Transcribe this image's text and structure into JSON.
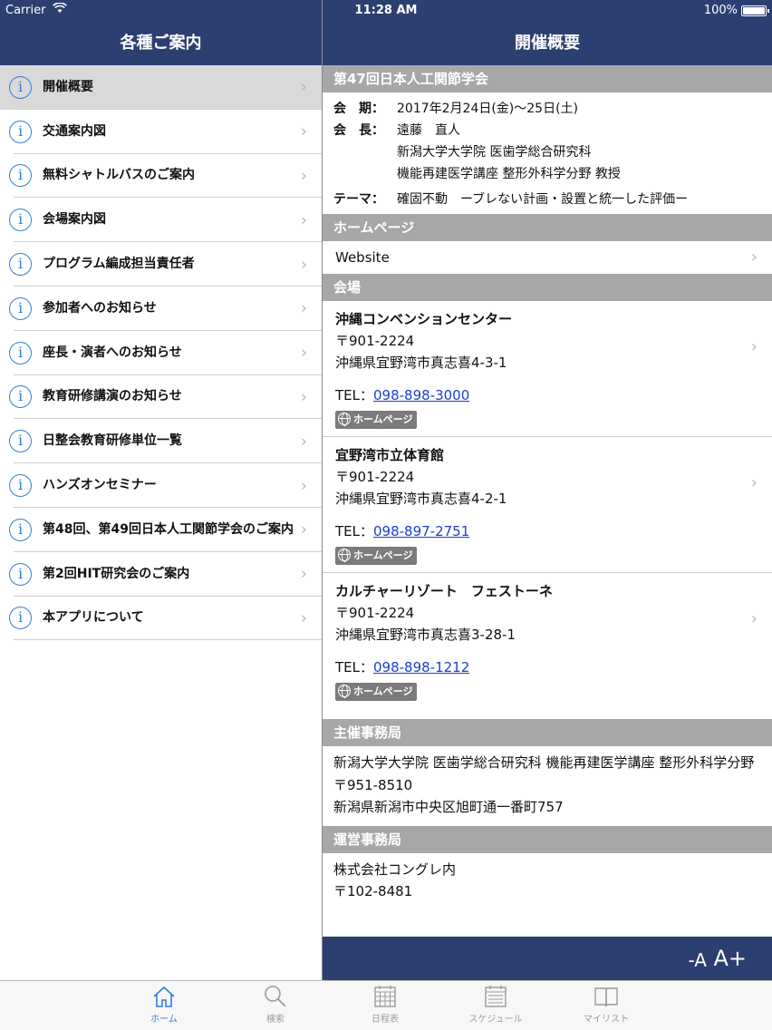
{
  "status": {
    "carrier": "Carrier",
    "time": "11:28 AM",
    "battery": "100%"
  },
  "left": {
    "title": "各種ご案内",
    "items": [
      {
        "label": "開催概要",
        "selected": true
      },
      {
        "label": "交通案内図"
      },
      {
        "label": "無料シャトルバスのご案内"
      },
      {
        "label": "会場案内図"
      },
      {
        "label": "プログラム編成担当責任者"
      },
      {
        "label": "参加者へのお知らせ"
      },
      {
        "label": "座長・演者へのお知らせ"
      },
      {
        "label": "教育研修講演のお知らせ"
      },
      {
        "label": "日整会教育研修単位一覧"
      },
      {
        "label": "ハンズオンセミナー"
      },
      {
        "label": "第48回、第49回日本人工関節学会のご案内"
      },
      {
        "label": "第2回HIT研究会のご案内"
      },
      {
        "label": "本アプリについて"
      }
    ]
  },
  "right": {
    "title": "開催概要",
    "conference_title": "第47回日本人工関節学会",
    "period_key": "会　期：",
    "period_value": "2017年2月24日(金)〜25日(土)",
    "chair_key": "会　長：",
    "chair_name": "遠藤　直人",
    "chair_affil1": "新潟大学大学院 医歯学総合研究科",
    "chair_affil2": "機能再建医学講座 整形外科学分野 教授",
    "theme_key": "テーマ：",
    "theme_value": "確固不動　ーブレない計画・設置と統一した評価ー",
    "homepage_header": "ホームページ",
    "website_label": "Website",
    "venue_header": "会場",
    "venues": [
      {
        "name": "沖縄コンベンションセンター",
        "zip": "〒901-2224",
        "address": "沖縄県宜野湾市真志喜4-3-1",
        "tel_label": "TEL：",
        "tel": "098-898-3000",
        "hp": "ホームページ"
      },
      {
        "name": "宜野湾市立体育館",
        "zip": "〒901-2224",
        "address": "沖縄県宜野湾市真志喜4-2-1",
        "tel_label": "TEL：",
        "tel": "098-897-2751",
        "hp": "ホームページ"
      },
      {
        "name": "カルチャーリゾート　フェストーネ",
        "zip": "〒901-2224",
        "address": "沖縄県宜野湾市真志喜3-28-1",
        "tel_label": "TEL：",
        "tel": "098-898-1212",
        "hp": "ホームページ"
      }
    ],
    "host_header": "主催事務局",
    "host_org": "新潟大学大学院 医歯学総合研究科 機能再建医学講座 整形外科学分野",
    "host_zip": "〒951-8510",
    "host_address": "新潟県新潟市中央区旭町通一番町757",
    "ops_header": "運営事務局",
    "ops_org": "株式会社コングレ内",
    "ops_zip": "〒102-8481",
    "font_smaller": "-A",
    "font_larger": "A+"
  },
  "tabs": [
    {
      "label": "ホーム",
      "icon": "home-icon",
      "active": true
    },
    {
      "label": "検索",
      "icon": "search-icon"
    },
    {
      "label": "日程表",
      "icon": "calendar-icon"
    },
    {
      "label": "スケジュール",
      "icon": "schedule-icon"
    },
    {
      "label": "マイリスト",
      "icon": "book-icon"
    }
  ],
  "colors": {
    "navbar": "#2d3f70",
    "section_header": "#a7a7a7",
    "accent": "#2f7fd8",
    "link": "#1a3fcc"
  }
}
